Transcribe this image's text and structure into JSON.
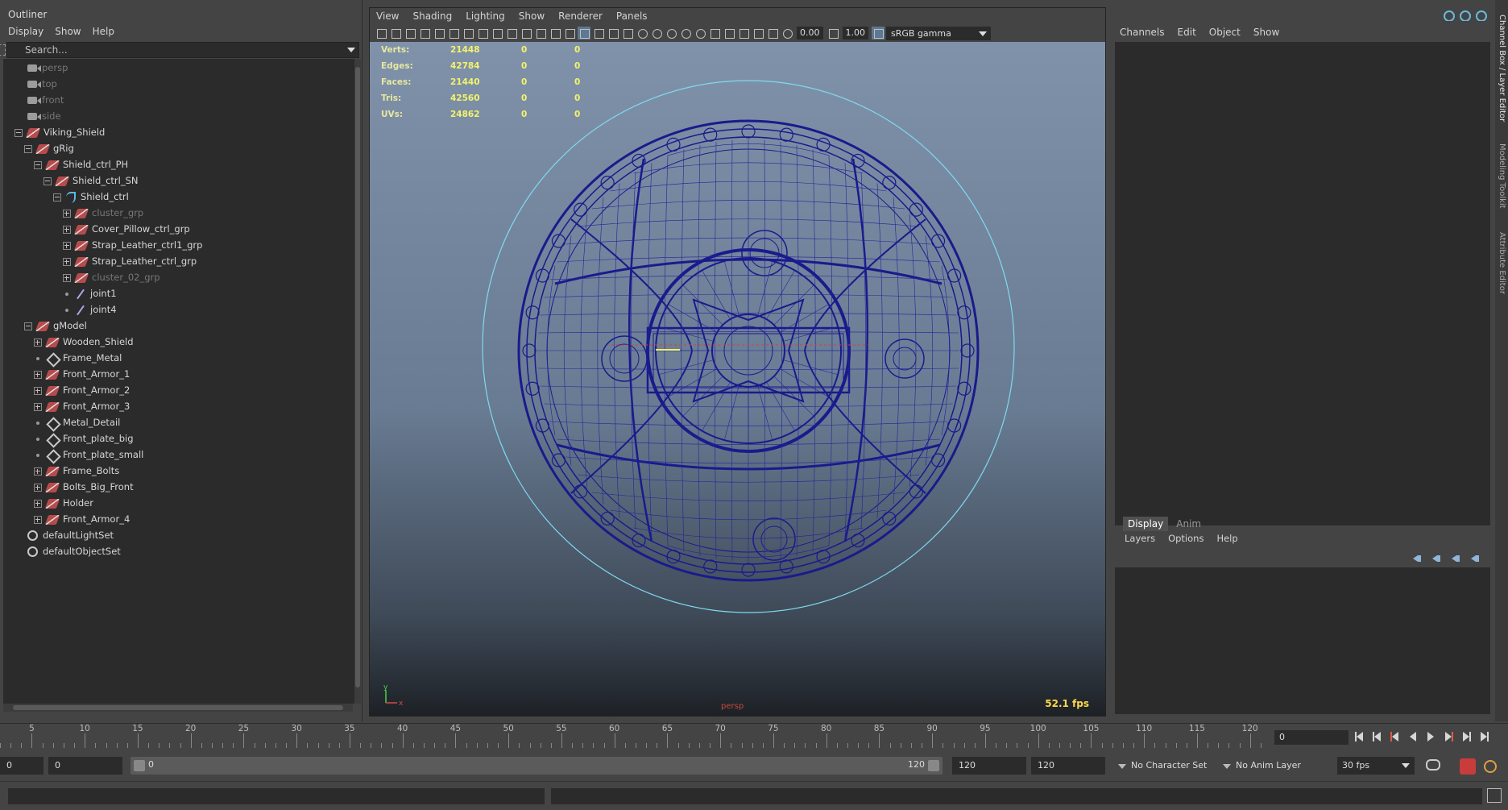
{
  "outliner": {
    "title": "Outliner",
    "menu": [
      "Display",
      "Show",
      "Help"
    ],
    "search_placeholder": "Search...",
    "items": [
      {
        "label": "persp",
        "icon": "camera-icon",
        "indent": 0,
        "expander": "none",
        "dim": true
      },
      {
        "label": "top",
        "icon": "camera-icon",
        "indent": 0,
        "expander": "none",
        "dim": true
      },
      {
        "label": "front",
        "icon": "camera-icon",
        "indent": 0,
        "expander": "none",
        "dim": true
      },
      {
        "label": "side",
        "icon": "camera-icon",
        "indent": 0,
        "expander": "none",
        "dim": true
      },
      {
        "label": "Viking_Shield",
        "icon": "group-icon",
        "indent": 0,
        "expander": "minus",
        "dim": false
      },
      {
        "label": "gRig",
        "icon": "group-icon",
        "indent": 1,
        "expander": "minus",
        "dim": false
      },
      {
        "label": "Shield_ctrl_PH",
        "icon": "group-icon",
        "indent": 2,
        "expander": "minus",
        "dim": false
      },
      {
        "label": "Shield_ctrl_SN",
        "icon": "group-icon",
        "indent": 3,
        "expander": "minus",
        "dim": false
      },
      {
        "label": "Shield_ctrl",
        "icon": "curve-icon",
        "indent": 4,
        "expander": "minus",
        "dim": false
      },
      {
        "label": "cluster_grp",
        "icon": "group-icon",
        "indent": 5,
        "expander": "plus",
        "dim": true
      },
      {
        "label": "Cover_Pillow_ctrl_grp",
        "icon": "group-icon",
        "indent": 5,
        "expander": "plus",
        "dim": false
      },
      {
        "label": "Strap_Leather_ctrl1_grp",
        "icon": "group-icon",
        "indent": 5,
        "expander": "plus",
        "dim": false
      },
      {
        "label": "Strap_Leather_ctrl_grp",
        "icon": "group-icon",
        "indent": 5,
        "expander": "plus",
        "dim": false
      },
      {
        "label": "cluster_02_grp",
        "icon": "group-icon",
        "indent": 5,
        "expander": "plus",
        "dim": true
      },
      {
        "label": "joint1",
        "icon": "joint-icon",
        "indent": 5,
        "expander": "dot",
        "dim": false
      },
      {
        "label": "joint4",
        "icon": "joint-icon",
        "indent": 5,
        "expander": "dot",
        "dim": false
      },
      {
        "label": "gModel",
        "icon": "group-icon",
        "indent": 1,
        "expander": "minus",
        "dim": false
      },
      {
        "label": "Wooden_Shield",
        "icon": "group-icon",
        "indent": 2,
        "expander": "plus",
        "dim": false
      },
      {
        "label": "Frame_Metal",
        "icon": "mesh-icon",
        "indent": 2,
        "expander": "dot",
        "dim": false
      },
      {
        "label": "Front_Armor_1",
        "icon": "group-icon",
        "indent": 2,
        "expander": "plus",
        "dim": false
      },
      {
        "label": "Front_Armor_2",
        "icon": "group-icon",
        "indent": 2,
        "expander": "plus",
        "dim": false
      },
      {
        "label": "Front_Armor_3",
        "icon": "group-icon",
        "indent": 2,
        "expander": "plus",
        "dim": false
      },
      {
        "label": "Metal_Detail",
        "icon": "mesh-icon",
        "indent": 2,
        "expander": "dot",
        "dim": false
      },
      {
        "label": "Front_plate_big",
        "icon": "mesh-icon",
        "indent": 2,
        "expander": "dot",
        "dim": false
      },
      {
        "label": "Front_plate_small",
        "icon": "mesh-icon",
        "indent": 2,
        "expander": "dot",
        "dim": false
      },
      {
        "label": "Frame_Bolts",
        "icon": "group-icon",
        "indent": 2,
        "expander": "plus",
        "dim": false
      },
      {
        "label": "Bolts_Big_Front",
        "icon": "group-icon",
        "indent": 2,
        "expander": "plus",
        "dim": false
      },
      {
        "label": "Holder",
        "icon": "group-icon",
        "indent": 2,
        "expander": "plus",
        "dim": false
      },
      {
        "label": "Front_Armor_4",
        "icon": "group-icon",
        "indent": 2,
        "expander": "plus",
        "dim": false
      },
      {
        "label": "defaultLightSet",
        "icon": "set-icon",
        "indent": 0,
        "expander": "none",
        "dim": false
      },
      {
        "label": "defaultObjectSet",
        "icon": "set-icon",
        "indent": 0,
        "expander": "none",
        "dim": false
      }
    ]
  },
  "viewport": {
    "menu": [
      "View",
      "Shading",
      "Lighting",
      "Show",
      "Renderer",
      "Panels"
    ],
    "exposure": "0.00",
    "gamma": "1.00",
    "color_space": "sRGB gamma",
    "camera": "persp",
    "fps": "52.1 fps",
    "hud": [
      {
        "label": "Verts:",
        "v1": "21448",
        "v2": "0",
        "v3": "0"
      },
      {
        "label": "Edges:",
        "v1": "42784",
        "v2": "0",
        "v3": "0"
      },
      {
        "label": "Faces:",
        "v1": "21440",
        "v2": "0",
        "v3": "0"
      },
      {
        "label": "Tris:",
        "v1": "42560",
        "v2": "0",
        "v3": "0"
      },
      {
        "label": "UVs:",
        "v1": "24862",
        "v2": "0",
        "v3": "0"
      }
    ],
    "axis": {
      "y": "y",
      "x": "x"
    },
    "colors": {
      "wire": "#1a1a8c",
      "ctrl_curve": "#7fd9f0",
      "hud_value": "#f3f36a"
    }
  },
  "channel_box": {
    "menu": [
      "Channels",
      "Edit",
      "Object",
      "Show"
    ]
  },
  "layer_editor": {
    "tabs": [
      "Display",
      "Anim"
    ],
    "active_tab": "Display",
    "menu": [
      "Layers",
      "Options",
      "Help"
    ]
  },
  "side_tabs": [
    "Channel Box / Layer Editor",
    "Modeling Toolkit",
    "Attribute Editor"
  ],
  "timeline": {
    "ticks": [
      5,
      10,
      15,
      20,
      25,
      30,
      35,
      40,
      45,
      50,
      55,
      60,
      65,
      70,
      75,
      80,
      85,
      90,
      95,
      100,
      105,
      110,
      115,
      120
    ],
    "current_frame": "0"
  },
  "range": {
    "start": "0",
    "inner_start": "0",
    "slider_start": "0",
    "slider_end": "120",
    "inner_end": "120",
    "end": "120",
    "character_set": "No Character Set",
    "anim_layer": "No Anim Layer",
    "fps": "30 fps"
  }
}
